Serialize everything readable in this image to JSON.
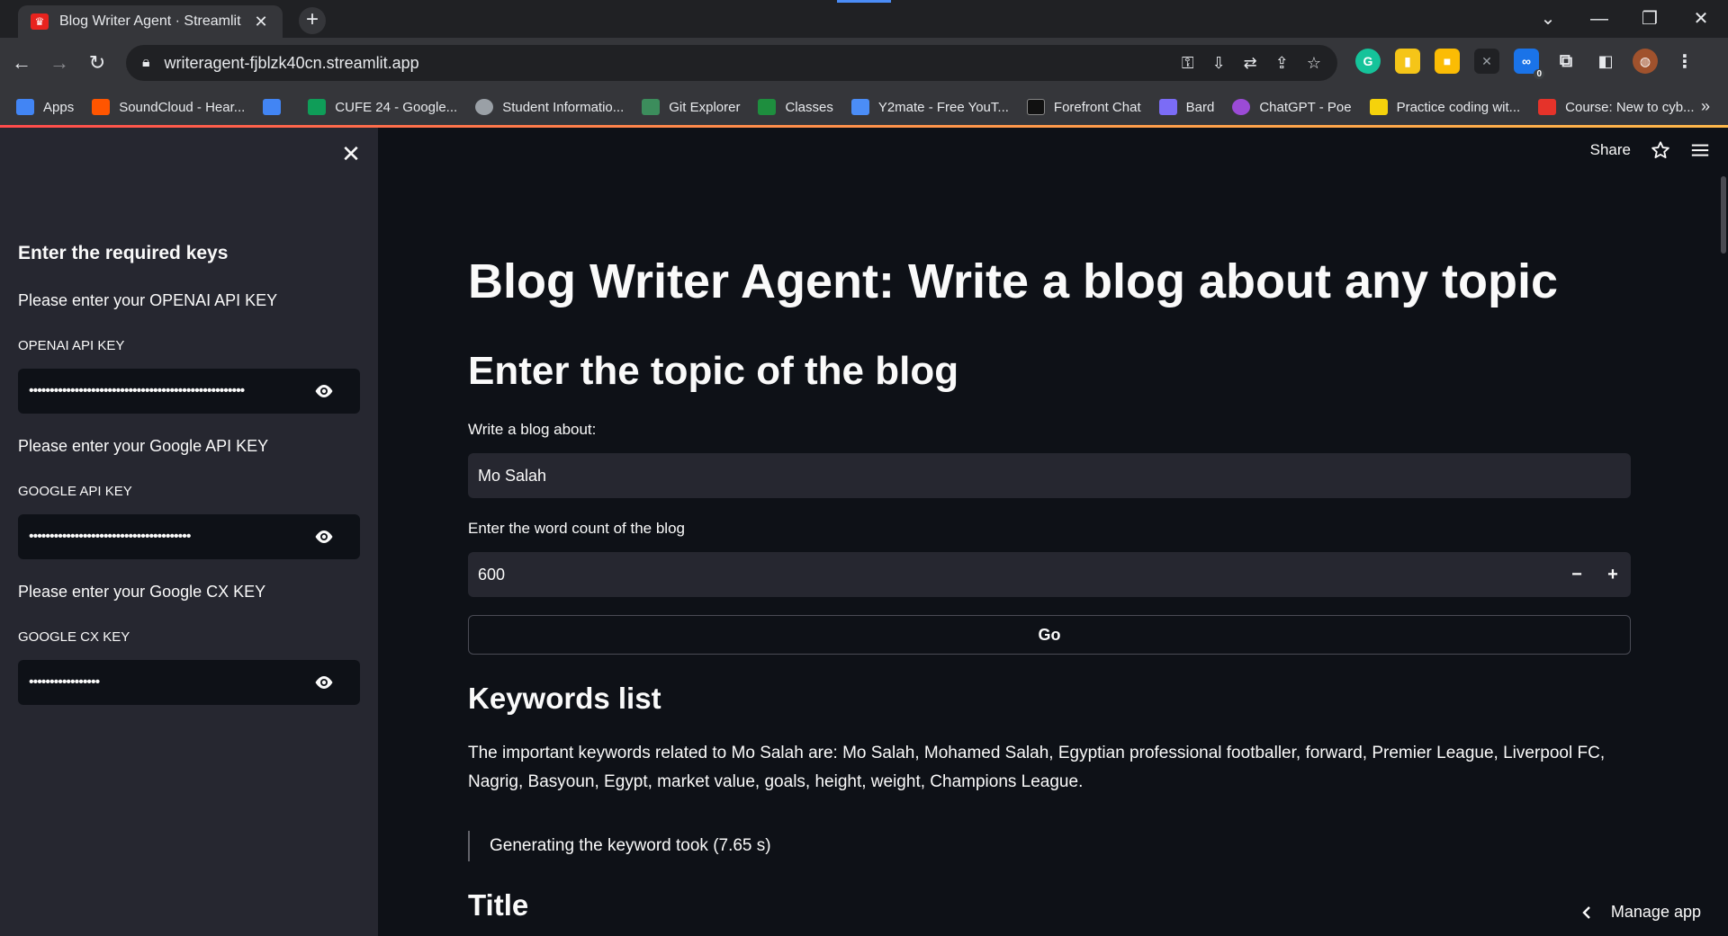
{
  "browser": {
    "tab_title": "Blog Writer Agent · Streamlit",
    "url": "writeragent-fjblzk40cn.streamlit.app",
    "ext_badge": "0",
    "bookmarks": [
      {
        "label": "Apps",
        "color": "#4285f4"
      },
      {
        "label": "SoundCloud - Hear...",
        "color": "#ff5500"
      },
      {
        "label": "",
        "color": "#4285f4"
      },
      {
        "label": "CUFE 24 - Google...",
        "color": "#0f9d58"
      },
      {
        "label": "Student Informatio...",
        "color": "#9aa0a6"
      },
      {
        "label": "Git Explorer",
        "color": "#3c8d5c"
      },
      {
        "label": "Classes",
        "color": "#1e8e3e"
      },
      {
        "label": "Y2mate - Free YouT...",
        "color": "#4b8df7"
      },
      {
        "label": "Forefront Chat",
        "color": "#111111"
      },
      {
        "label": "Bard",
        "color": "#7b6cf6"
      },
      {
        "label": "ChatGPT - Poe",
        "color": "#9b4bd6"
      },
      {
        "label": "Practice coding wit...",
        "color": "#f5d20b"
      },
      {
        "label": "Course: New to cyb...",
        "color": "#e5332a"
      }
    ]
  },
  "sidebar": {
    "heading": "Enter the required keys",
    "openai_prompt": "Please enter your OPENAI API KEY",
    "openai_label": "OPENAI API KEY",
    "openai_value": "••••••••••••••••••••••••••••••••••••••••••••••••••••",
    "google_prompt": "Please enter your Google API KEY",
    "google_label": "GOOGLE API KEY",
    "google_value": "•••••••••••••••••••••••••••••••••••••••",
    "cx_prompt": "Please enter your Google CX KEY",
    "cx_label": "GOOGLE CX KEY",
    "cx_value": "•••••••••••••••••"
  },
  "header": {
    "share_label": "Share"
  },
  "main": {
    "title": "Blog Writer Agent: Write a blog about any topic",
    "subtitle": "Enter the topic of the blog",
    "topic_label": "Write a blog about:",
    "topic_value": "Mo Salah",
    "wordcount_label": "Enter the word count of the blog",
    "wordcount_value": "600",
    "minus": "−",
    "plus": "+",
    "go_label": "Go",
    "keywords_heading": "Keywords list",
    "keywords_text": "The important keywords related to Mo Salah are: Mo Salah, Mohamed Salah, Egyptian professional footballer, forward, Premier League, Liverpool FC, Nagrig, Basyoun, Egypt, market value, goals, height, weight, Champions League.",
    "timing_text": "Generating the keyword took (7.65 s)",
    "title_heading": "Title",
    "manage_label": "Manage app"
  }
}
